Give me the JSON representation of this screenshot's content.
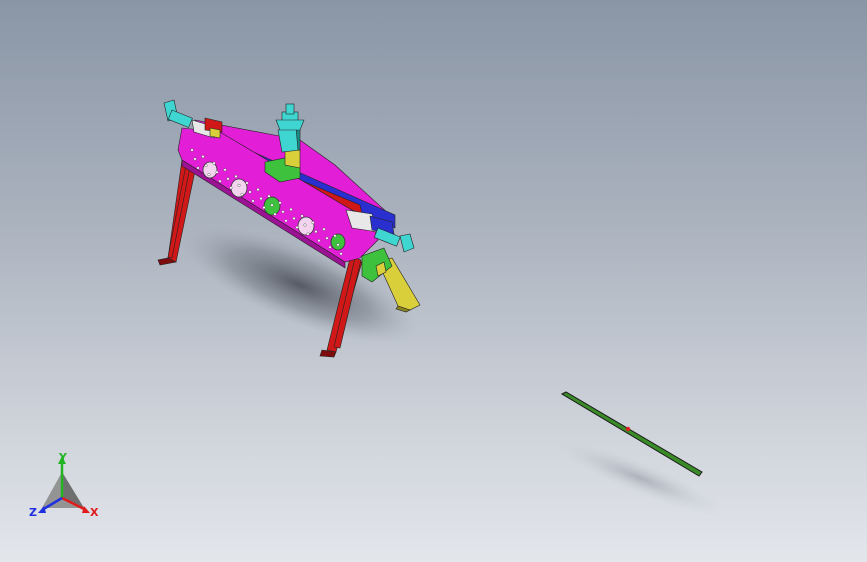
{
  "viewport": {
    "background_top": "#8a96a6",
    "background_bottom": "#e3e6eb"
  },
  "model": {
    "colors": {
      "magenta": "#e21fd6",
      "magenta_dark": "#9c1294",
      "red": "#d01818",
      "red_dark": "#7e0c0c",
      "cyan": "#3fd6d2",
      "cyan_dark": "#1c8e8a",
      "blue": "#2a2fd0",
      "green": "#3ec23e",
      "yellow": "#d9cf3a",
      "yellow_dark": "#8a8320",
      "white": "#e8e8e8"
    }
  },
  "small_part": {
    "color": "#3a8a28",
    "marker_color": "#e02020"
  },
  "triad": {
    "x_label": "X",
    "y_label": "Y",
    "z_label": "Z",
    "x_color": "#e01c1c",
    "y_color": "#22b422",
    "z_color": "#2030e0"
  }
}
